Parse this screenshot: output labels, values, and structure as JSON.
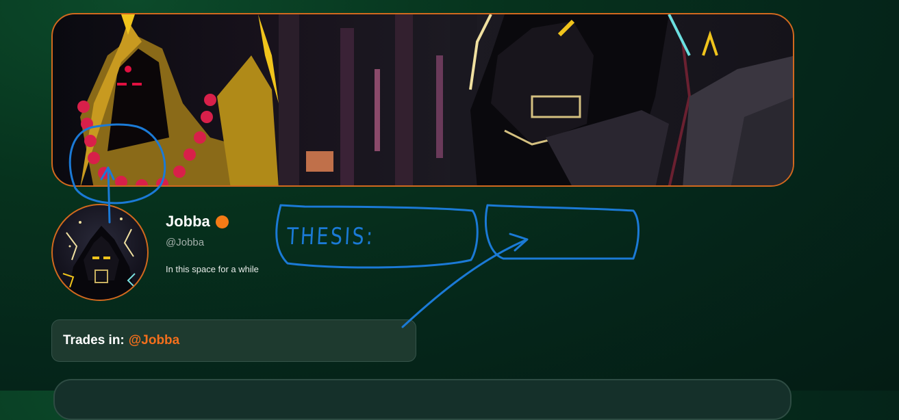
{
  "profile": {
    "name": "Jobba",
    "handle": "@Jobba",
    "bio": "In this space for a while",
    "verified_color": "#f47b16"
  },
  "trades": {
    "label": "Trades in:",
    "link": "@Jobba"
  },
  "annotation": {
    "text": "THESIS:",
    "color": "#1b7ad6"
  },
  "colors": {
    "accent": "#d2691e",
    "link": "#f46f1c"
  }
}
